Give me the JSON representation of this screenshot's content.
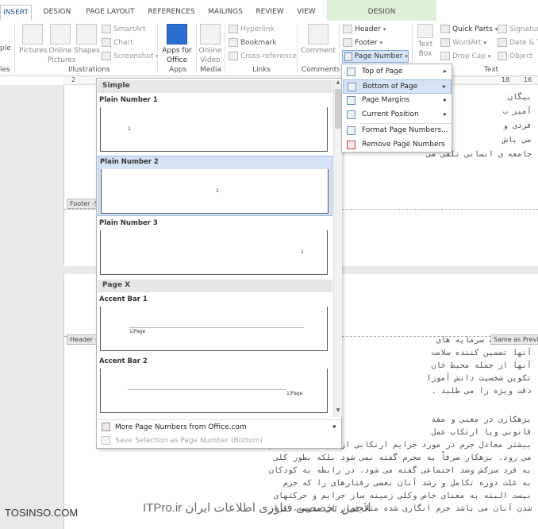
{
  "tabs": [
    {
      "label": "INSERT",
      "active": true
    },
    {
      "label": "DESIGN"
    },
    {
      "label": "PAGE LAYOUT"
    },
    {
      "label": "REFERENCES"
    },
    {
      "label": "MAILINGS"
    },
    {
      "label": "REVIEW"
    },
    {
      "label": "VIEW"
    }
  ],
  "contextual_tab": {
    "label": "DESIGN"
  },
  "ribbon": {
    "cut_left": "ple",
    "cut_left_group": "les",
    "pictures": "Pictures",
    "online_pictures_1": "Online",
    "online_pictures_2": "Pictures",
    "shapes": "Shapes",
    "smartart": "SmartArt",
    "chart": "Chart",
    "screenshot": "Screenshot",
    "illustrations_group": "Illustrations",
    "apps_1": "Apps for",
    "apps_2": "Office",
    "apps_group": "Apps",
    "online_video_1": "Online",
    "online_video_2": "Video",
    "media_group": "Media",
    "hyperlink": "Hyperlink",
    "bookmark": "Bookmark",
    "cross_reference": "Cross-reference",
    "links_group": "Links",
    "comment": "Comment",
    "comments_group": "Comments",
    "header": "Header",
    "footer": "Footer",
    "page_number": "Page Number",
    "text_box_1": "Text",
    "text_box_2": "Box",
    "quick_parts": "Quick Parts",
    "wordart": "WordArt",
    "drop_cap": "Drop Cap",
    "signature": "Signature",
    "date_time": "Date & T",
    "object": "Object",
    "text_group": "Text",
    "accent": "#2b579a",
    "contextual_color": "#dff0d8"
  },
  "ruler": {
    "n2": "2",
    "n18": "18",
    "n16": "16"
  },
  "gallery": {
    "section_simple": "Simple",
    "items": [
      {
        "name": "Plain Number 1",
        "mark": "1"
      },
      {
        "name": "Plain Number 2",
        "mark": "1"
      },
      {
        "name": "Plain Number 3",
        "mark": "1"
      }
    ],
    "section_page_x": "Page X",
    "accent_items": [
      {
        "name": "Accent Bar 1",
        "mark": "1|Page"
      },
      {
        "name": "Accent Bar 2",
        "mark": "1|Page"
      }
    ],
    "more": "More Page Numbers from Office.com",
    "save": "Save Selection as Page Number (Bottom)"
  },
  "menu": {
    "top_of_page": "Top of Page",
    "bottom_of_page": "Bottom of Page",
    "page_margins": "Page Margins",
    "current_position": "Current Position",
    "format_page_numbers": "Format Page Numbers...",
    "remove_page_numbers": "Remove Page Numbers"
  },
  "document": {
    "p1_lines": [
      "بیگان",
      "آمیز ب",
      "فردی و",
      "می باش",
      "جامعه ی انسانی تلقی می"
    ],
    "footer_tag": "Footer -S",
    "header_tag": "Header -",
    "same_as_previous": "Same as Previo",
    "p2_lines": [
      "کودکان که سرمایه های",
      "آنها تضمین کننده سلامت",
      "آنها از جمله محیط خان",
      "تکوین شخصیت دانش آموزا",
      "دقت ویژه را می طلبد ."
    ],
    "p3_lines": [
      "بزهکاری در معنی و مفه",
      "قانونی ویا ارتکاب عمل",
      "بیشتر معادل جرم در مورد جرایم ارتکابی از سوی اطفال بکار",
      "می رود. بزهکار صرفاً به مجرم گفته نمی شود بلکه بطور کلی",
      "به فرد سرکش وضد اجتماعی گفته می شود. در رابطه به کودکان",
      "به علت دوره تکامل و رشد آنان بعضی رفتارهای را که جرم",
      "نیست البته به معنای خاص وکلی زمینه ساز جرایم و حرکتهای",
      "شدن آنان می باشد جرم انگاری شده مثلاً فرار از مدرسه، فرار"
    ]
  },
  "watermark": {
    "left": "TOSINSO.COM",
    "right": "ITPro.ir انجمن تخصصی فناوری اطلاعات ایران"
  }
}
